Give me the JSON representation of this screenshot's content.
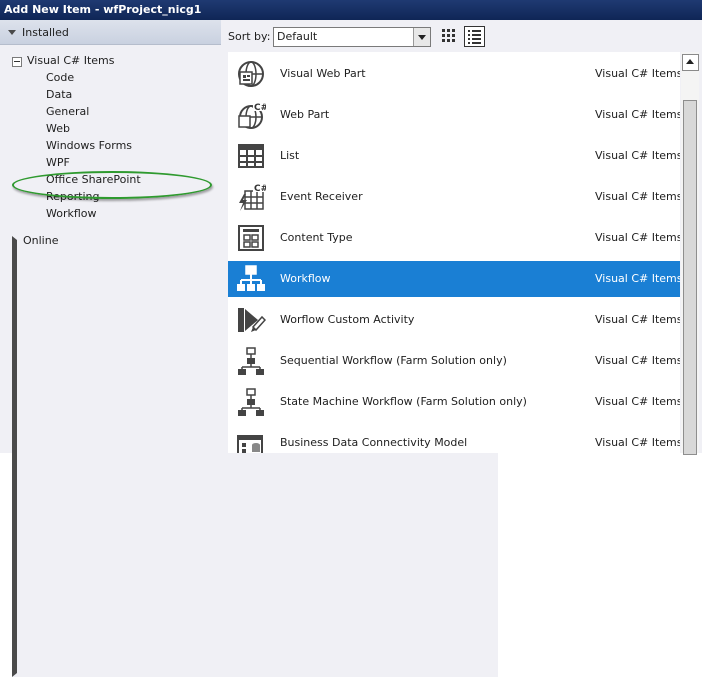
{
  "window": {
    "title": "Add New Item - wfProject_nicg1"
  },
  "tree": {
    "installed_label": "Installed",
    "root_label": "Visual C# Items",
    "children": [
      "Code",
      "Data",
      "General",
      "Web",
      "Windows Forms",
      "WPF",
      "Office SharePoint",
      "Reporting",
      "Workflow"
    ],
    "online_label": "Online"
  },
  "toolbar": {
    "sort_label": "Sort by:",
    "sort_value": "Default"
  },
  "items": [
    {
      "name": "Visual Web Part",
      "category": "Visual C# Items",
      "icon": "visual-web-part-icon"
    },
    {
      "name": "Web Part",
      "category": "Visual C# Items",
      "icon": "web-part-icon"
    },
    {
      "name": "List",
      "category": "Visual C# Items",
      "icon": "list-icon"
    },
    {
      "name": "Event Receiver",
      "category": "Visual C# Items",
      "icon": "event-receiver-icon"
    },
    {
      "name": "Content Type",
      "category": "Visual C# Items",
      "icon": "content-type-icon"
    },
    {
      "name": "Workflow",
      "category": "Visual C# Items",
      "icon": "workflow-icon"
    },
    {
      "name": "Worflow Custom Activity",
      "category": "Visual C# Items",
      "icon": "custom-activity-icon"
    },
    {
      "name": "Sequential Workflow (Farm Solution only)",
      "category": "Visual C# Items",
      "icon": "sequential-workflow-icon"
    },
    {
      "name": "State Machine Workflow (Farm Solution only)",
      "category": "Visual C# Items",
      "icon": "state-machine-workflow-icon"
    },
    {
      "name": "Business Data Connectivity Model",
      "category": "Visual C# Items",
      "icon": "bdc-model-icon"
    }
  ],
  "selected_index": 5,
  "colors": {
    "selection": "#1a7fd4",
    "highlight_ellipse": "#2f9a2f",
    "titlebar": "#1f3a72"
  }
}
